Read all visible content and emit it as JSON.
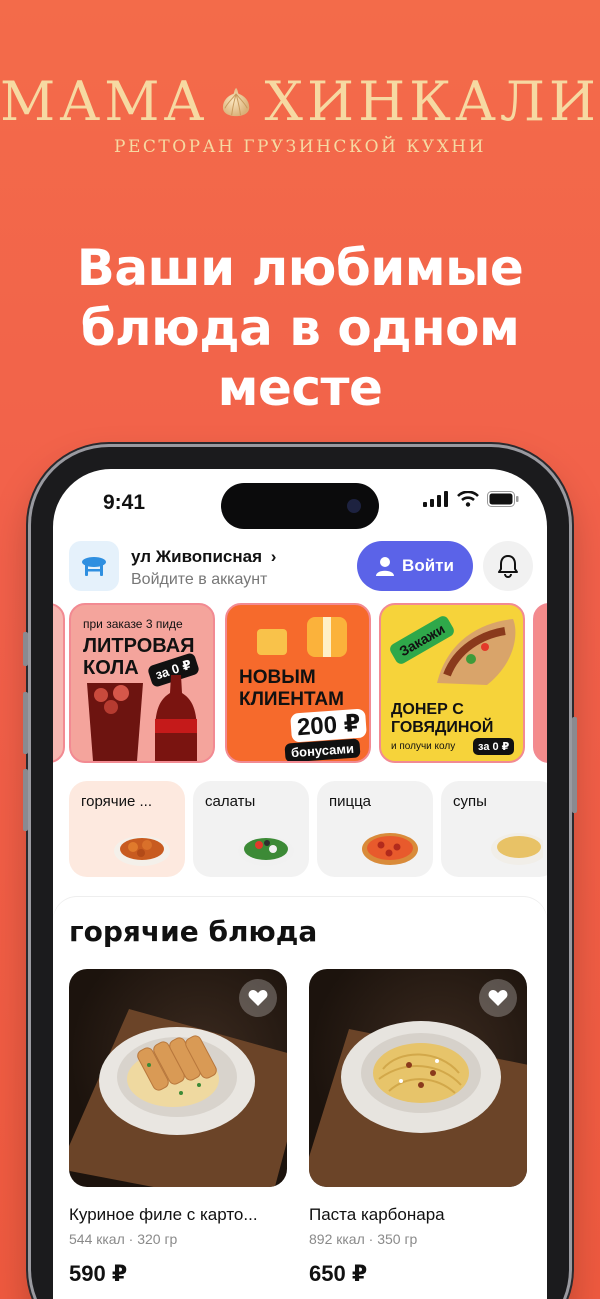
{
  "logo": {
    "left_word": "МАМА",
    "right_word": "ХИНКАЛИ",
    "subtitle": "РЕСТОРАН ГРУЗИНСКОЙ КУХНИ",
    "color": "#f6d9a2"
  },
  "hero": {
    "line1": "Ваши любимые",
    "line2": "блюда в одном",
    "line3": "месте"
  },
  "status_bar": {
    "time": "9:41"
  },
  "header": {
    "street": "ул Живописная",
    "chevron": "›",
    "subtitle": "Войдите в аккаунт",
    "login_label": "Войти",
    "accent": "#5b63e8"
  },
  "banners": [
    {
      "top": "при заказе 3 пиде",
      "title1": "ЛИТРОВАЯ",
      "title2": "КОЛА",
      "tag": "за 0 ₽"
    },
    {
      "title1": "НОВЫМ",
      "title2": "КЛИЕНТАМ",
      "amount": "200 ₽",
      "note": "бонусами"
    },
    {
      "badge": "Закажи",
      "title1": "ДОНЕР С",
      "title2": "ГОВЯДИНОЙ",
      "note": "и получи колу",
      "tag": "за 0 ₽"
    }
  ],
  "categories": [
    {
      "label": "горячие ...",
      "active": true
    },
    {
      "label": "салаты",
      "active": false
    },
    {
      "label": "пицца",
      "active": false
    },
    {
      "label": "супы",
      "active": false
    }
  ],
  "section": {
    "title": "горячие блюда",
    "items": [
      {
        "name": "Куриное филе с карто...",
        "meta": "544 ккал · 320 гр",
        "price": "590 ₽"
      },
      {
        "name": "Паста карбонара",
        "meta": "892 ккал · 350 гр",
        "price": "650 ₽"
      }
    ]
  },
  "colors": {
    "background": "#f2604a",
    "banner_border": "#f28a92"
  }
}
